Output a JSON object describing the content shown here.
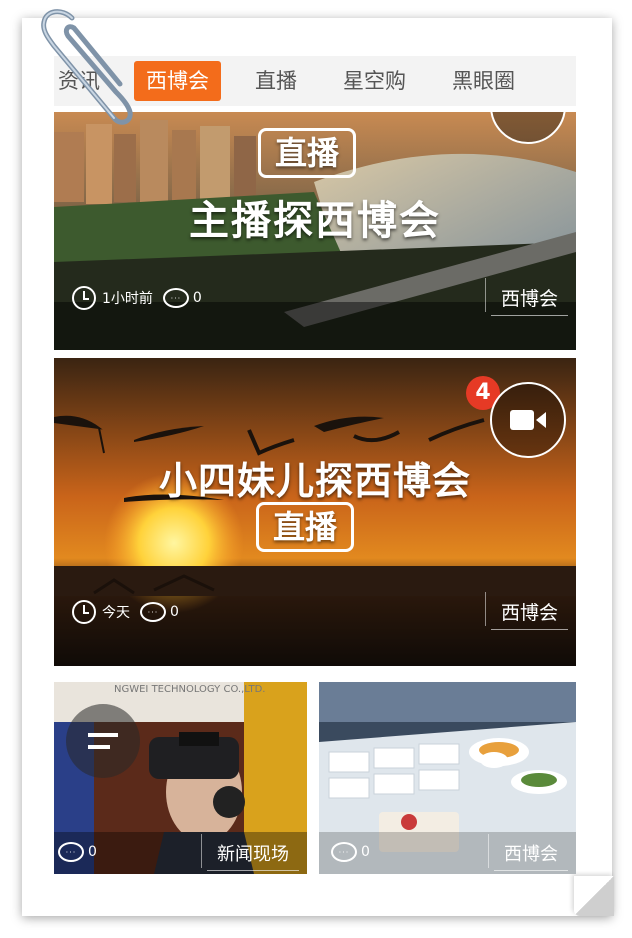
{
  "tabs": [
    "资讯",
    "西博会",
    "直播",
    "星空购",
    "黑眼圈"
  ],
  "active_tab": "西博会",
  "cards": [
    {
      "headline_top": "直播",
      "headline_main": "主播探西博会",
      "time": "1小时前",
      "comments": "0",
      "category": "西博会"
    },
    {
      "headline_main": "小四妹儿探西博会",
      "headline_bottom": "直播",
      "badge": "4",
      "time": "今天",
      "comments": "0",
      "category": "西博会"
    }
  ],
  "small_cards": [
    {
      "comments": "0",
      "category": "新闻现场",
      "sign_text": "NGWEI TECHNOLOGY CO.,LTD."
    },
    {
      "comments": "0",
      "category": "西博会"
    }
  ],
  "colors": {
    "accent": "#f36c1b",
    "tab_bg": "#f3f3f3"
  }
}
